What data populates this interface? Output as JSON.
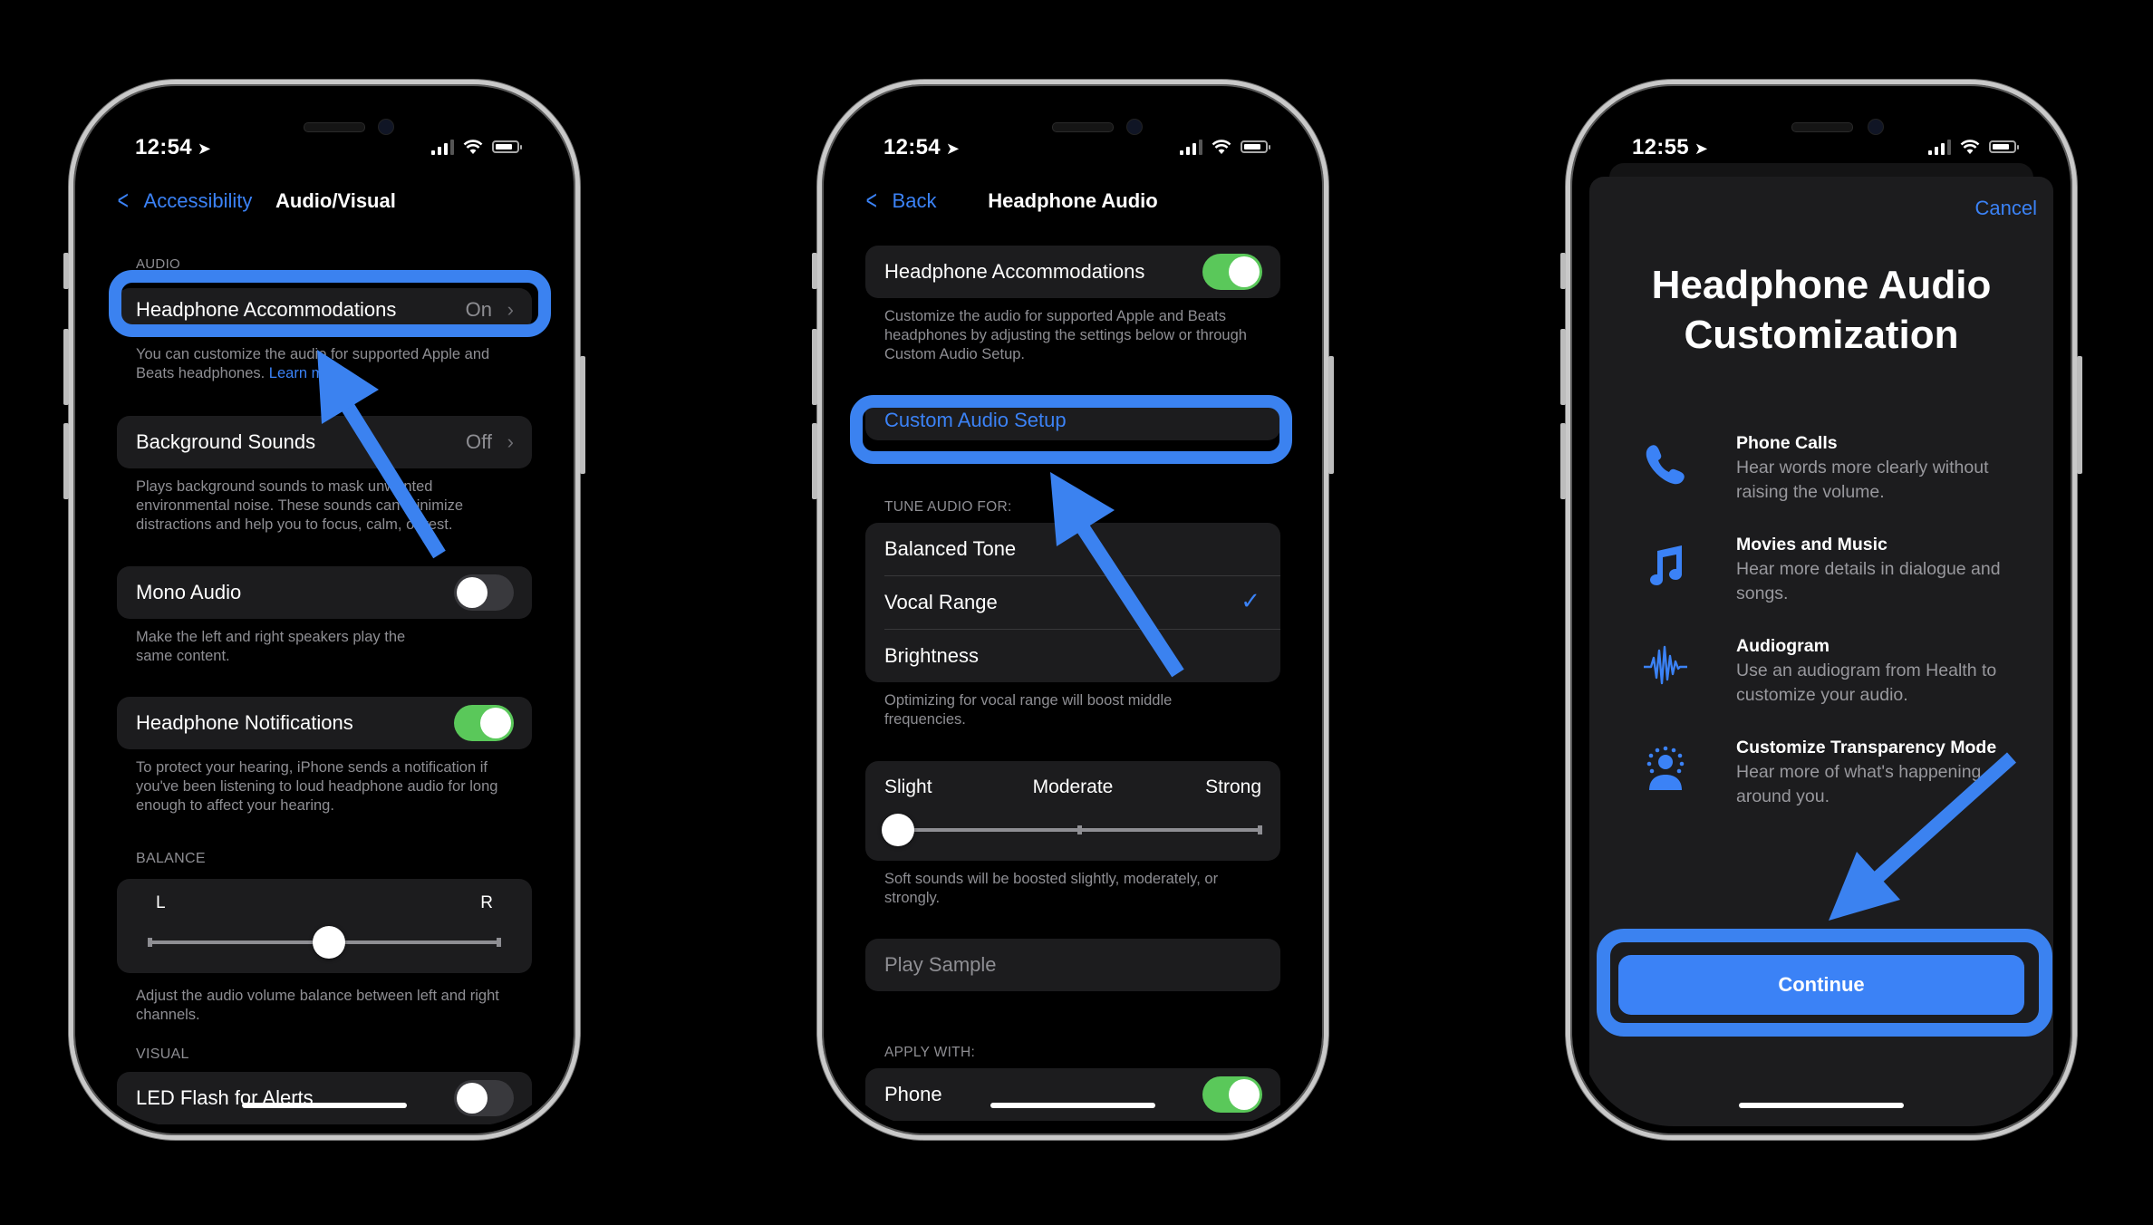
{
  "colors": {
    "accent": "#3b82f6",
    "annotation": "#3b82f0",
    "toggle_on": "#5ac85a",
    "cell_bg": "#1c1c1e"
  },
  "phone1": {
    "status": {
      "time": "12:54",
      "location_icon": "location-arrow-icon"
    },
    "nav": {
      "back_label": "Accessibility",
      "title": "Audio/Visual"
    },
    "sections": {
      "audio_header": "AUDIO",
      "balance_header": "BALANCE",
      "visual_header": "VISUAL"
    },
    "headphone_accommodations": {
      "label": "Headphone Accommodations",
      "value": "On"
    },
    "headphone_accommodations_footer": "You can customize the audio for supported Apple and Beats headphones.",
    "learn_more": "Learn more...",
    "background_sounds": {
      "label": "Background Sounds",
      "value": "Off",
      "footer": "Plays background sounds to mask unwanted environmental noise. These sounds can minimize distractions and help you to focus, calm, or rest."
    },
    "mono_audio": {
      "label": "Mono Audio",
      "on": false,
      "footer": "Make the left and right speakers play the same content."
    },
    "headphone_notifications": {
      "label": "Headphone Notifications",
      "on": true,
      "footer": "To protect your hearing, iPhone sends a notification if you've been listening to loud headphone audio for long enough to affect your hearing."
    },
    "balance": {
      "left_label": "L",
      "right_label": "R",
      "value": 0.5,
      "footer": "Adjust the audio volume balance between left and right channels."
    },
    "led_flash": {
      "label": "LED Flash for Alerts",
      "on": false
    }
  },
  "phone2": {
    "status": {
      "time": "12:54"
    },
    "nav": {
      "back_label": "Back",
      "title": "Headphone Audio"
    },
    "headphone_accommodations": {
      "label": "Headphone Accommodations",
      "on": true,
      "footer": "Customize the audio for supported Apple and Beats headphones by adjusting the settings below or through Custom Audio Setup."
    },
    "custom_audio_setup": "Custom Audio Setup",
    "tune_header": "TUNE AUDIO FOR:",
    "tune_options": [
      {
        "label": "Balanced Tone",
        "selected": false
      },
      {
        "label": "Vocal Range",
        "selected": true
      },
      {
        "label": "Brightness",
        "selected": false
      }
    ],
    "tune_footer": "Optimizing for vocal range will boost middle frequencies.",
    "boost": {
      "labels": [
        "Slight",
        "Moderate",
        "Strong"
      ],
      "value": 0,
      "footer": "Soft sounds will be boosted slightly, moderately, or strongly."
    },
    "play_sample": "Play Sample",
    "apply_header": "APPLY WITH:",
    "phone_toggle": {
      "label": "Phone",
      "on": true
    }
  },
  "phone3": {
    "status": {
      "time": "12:55"
    },
    "cancel": "Cancel",
    "title_line1": "Headphone Audio",
    "title_line2": "Customization",
    "features": [
      {
        "icon": "phone-icon",
        "title": "Phone Calls",
        "desc": "Hear words more clearly without raising the volume."
      },
      {
        "icon": "music-note-icon",
        "title": "Movies and Music",
        "desc": "Hear more details in dialogue and songs."
      },
      {
        "icon": "waveform-icon",
        "title": "Audiogram",
        "desc": "Use an audiogram from Health to customize your audio."
      },
      {
        "icon": "person-transparency-icon",
        "title": "Customize Transparency Mode",
        "desc": "Hear more of what's happening around you."
      }
    ],
    "continue": "Continue"
  }
}
